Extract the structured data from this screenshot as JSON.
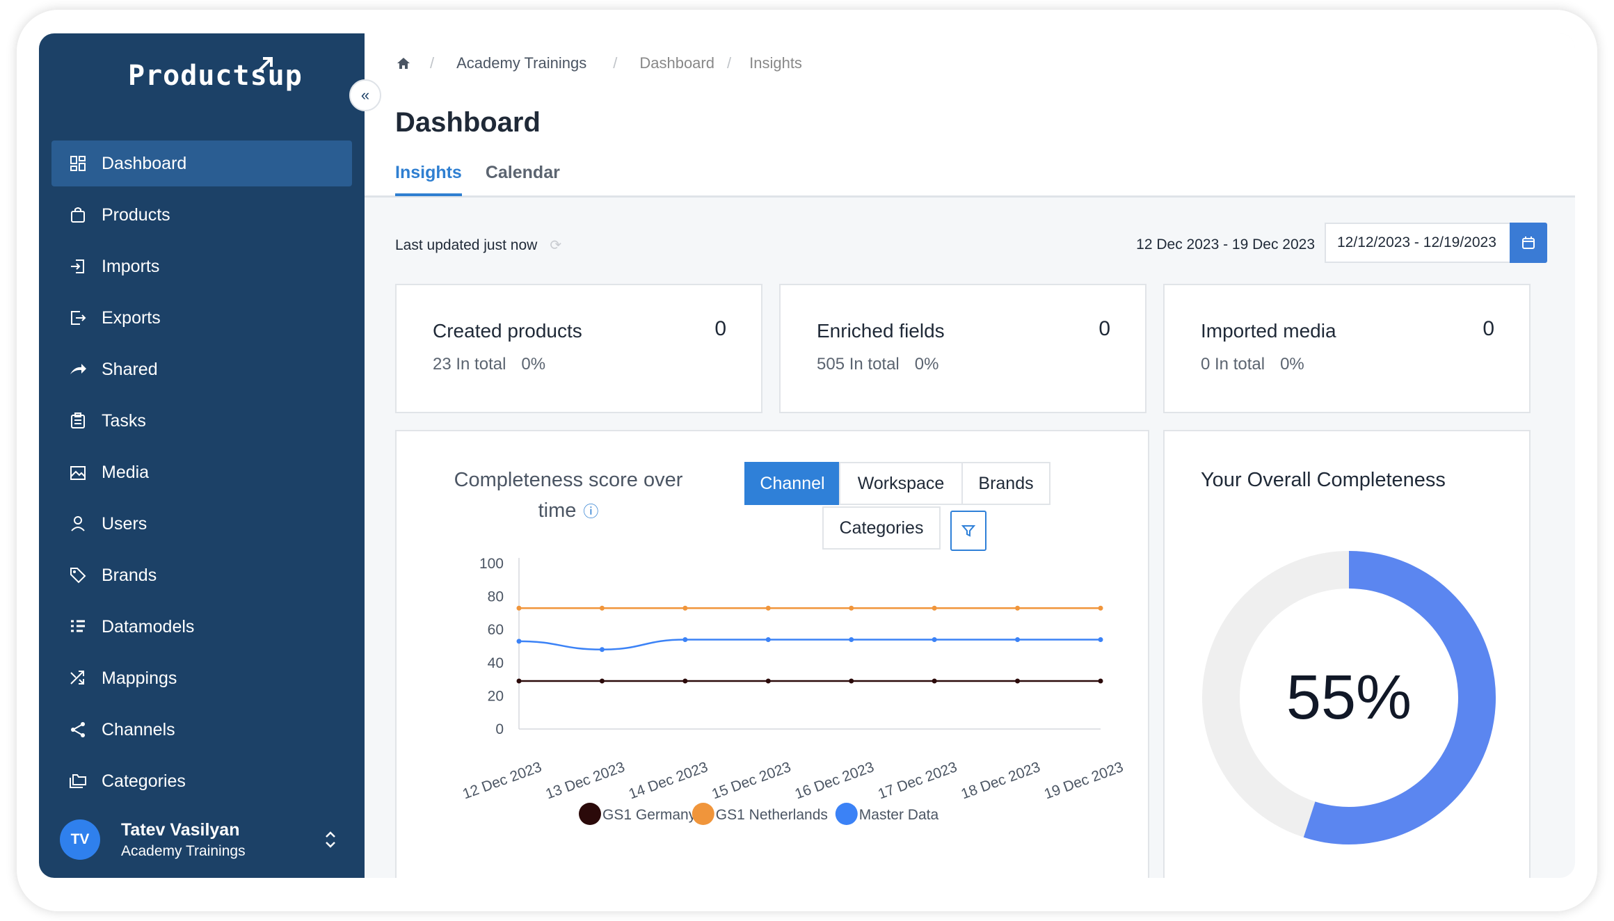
{
  "sidebar": {
    "logo": "Productsup",
    "items": [
      {
        "label": "Dashboard",
        "icon": "dashboard-icon",
        "active": true
      },
      {
        "label": "Products",
        "icon": "bag-icon"
      },
      {
        "label": "Imports",
        "icon": "import-icon"
      },
      {
        "label": "Exports",
        "icon": "export-icon"
      },
      {
        "label": "Shared",
        "icon": "share-arrow-icon"
      },
      {
        "label": "Tasks",
        "icon": "clipboard-icon"
      },
      {
        "label": "Media",
        "icon": "image-icon"
      },
      {
        "label": "Users",
        "icon": "user-icon"
      },
      {
        "label": "Brands",
        "icon": "tag-icon"
      },
      {
        "label": "Datamodels",
        "icon": "list-icon"
      },
      {
        "label": "Mappings",
        "icon": "shuffle-icon"
      },
      {
        "label": "Channels",
        "icon": "share-nodes-icon"
      },
      {
        "label": "Categories",
        "icon": "folders-icon"
      }
    ],
    "user": {
      "initials": "TV",
      "name": "Tatev Vasilyan",
      "org": "Academy Trainings"
    }
  },
  "breadcrumb": {
    "items": [
      "Academy Trainings",
      "Dashboard",
      "Insights"
    ]
  },
  "header": {
    "title": "Dashboard",
    "tabs": [
      "Insights",
      "Calendar"
    ]
  },
  "toolbar": {
    "last_updated": "Last updated just now",
    "date_range_label": "12 Dec 2023 - 19 Dec 2023",
    "date_input_value": "12/12/2023 - 12/19/2023"
  },
  "stats": [
    {
      "title": "Created products",
      "value": "0",
      "total": "23 In total",
      "percent": "0%"
    },
    {
      "title": "Enriched fields",
      "value": "0",
      "total": "505 In total",
      "percent": "0%"
    },
    {
      "title": "Imported media",
      "value": "0",
      "total": "0 In total",
      "percent": "0%"
    }
  ],
  "chart_panel": {
    "title": "Completeness score over time",
    "segments": [
      "Channel",
      "Workspace",
      "Brands",
      "Categories"
    ],
    "active_segment": "Channel"
  },
  "chart_data": {
    "type": "line",
    "x": [
      "12 Dec 2023",
      "13 Dec 2023",
      "14 Dec 2023",
      "15 Dec 2023",
      "16 Dec 2023",
      "17 Dec 2023",
      "18 Dec 2023",
      "19 Dec 2023"
    ],
    "ylim": [
      0,
      100
    ],
    "yticks": [
      0,
      20,
      40,
      60,
      80,
      100
    ],
    "grid": false,
    "legend": "bottom",
    "series": [
      {
        "name": "GS1 Germany",
        "color": "#2b0a0a",
        "values": [
          29,
          29,
          29,
          29,
          29,
          29,
          29,
          29
        ]
      },
      {
        "name": "GS1 Netherlands",
        "color": "#f0953b",
        "values": [
          73,
          73,
          73,
          73,
          73,
          73,
          73,
          73
        ]
      },
      {
        "name": "Master Data",
        "color": "#3b82f6",
        "values": [
          53,
          48,
          54,
          54,
          54,
          54,
          54,
          54
        ]
      }
    ]
  },
  "completeness": {
    "title": "Your Overall Completeness",
    "value": 55,
    "label": "55%",
    "color": "#5b86f0",
    "track_color": "#efefef"
  }
}
